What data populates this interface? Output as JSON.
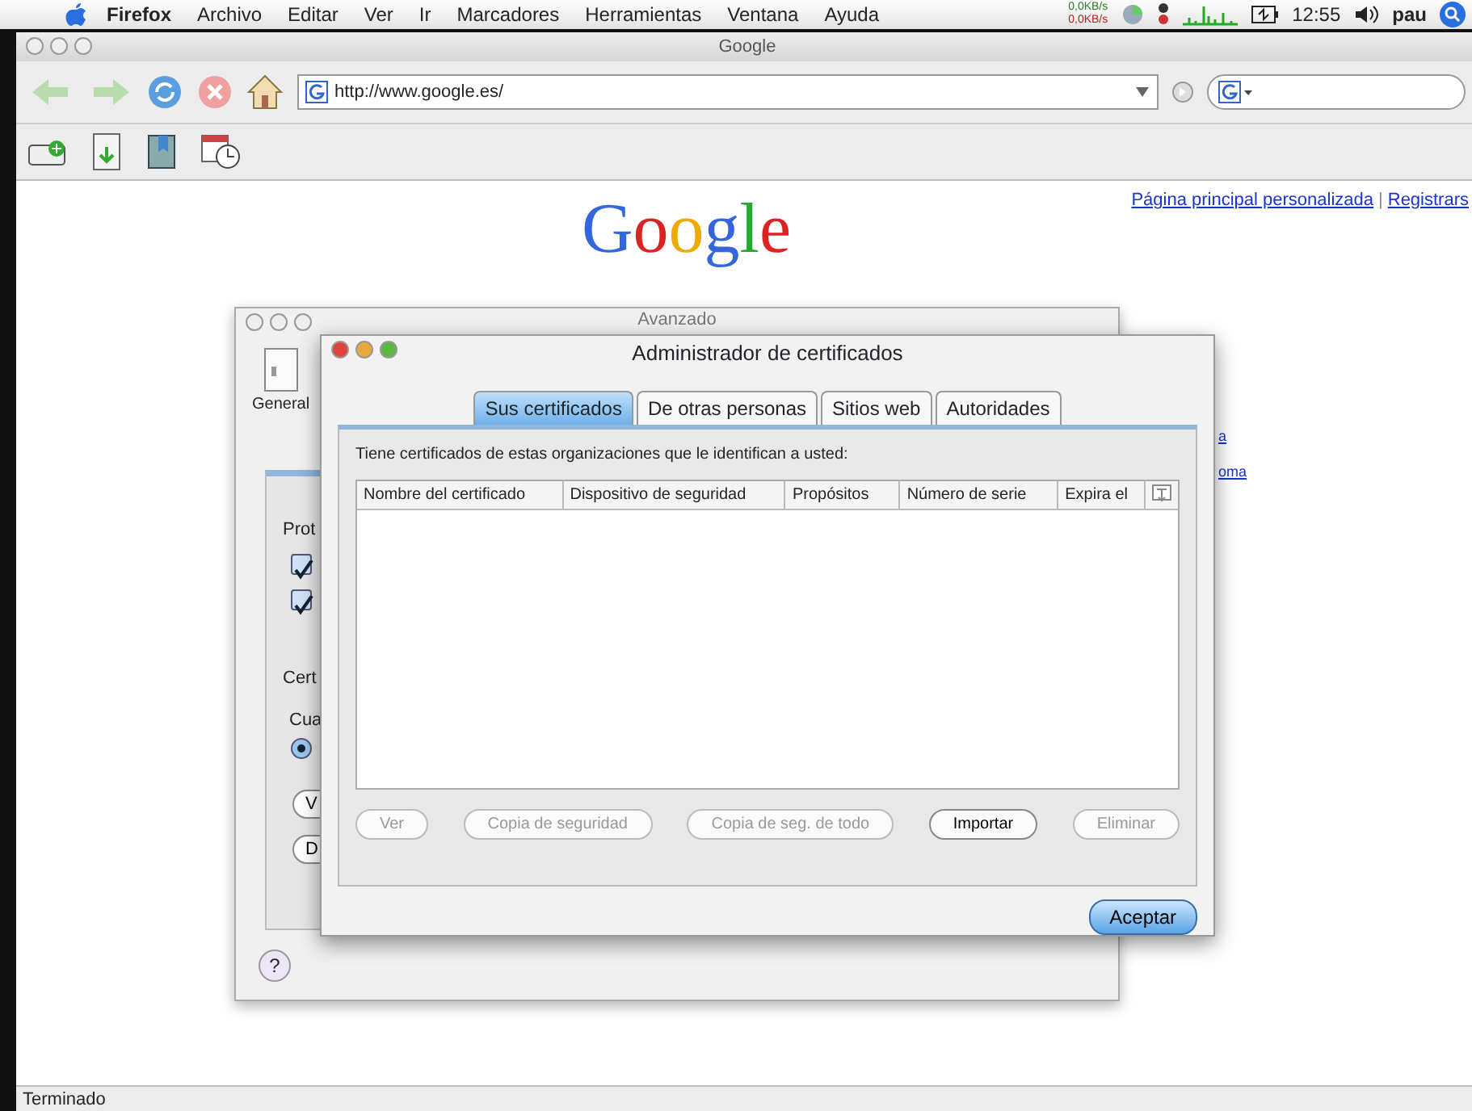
{
  "menubar": {
    "app": "Firefox",
    "menus": [
      "Archivo",
      "Editar",
      "Ver",
      "Ir",
      "Marcadores",
      "Herramientas",
      "Ventana",
      "Ayuda"
    ],
    "net_speed": [
      "0,0KB/s",
      "0,0KB/s"
    ],
    "clock": "12:55",
    "user": "pau"
  },
  "browser": {
    "title": "Google",
    "url": "http://www.google.es/",
    "logo": "Google",
    "header_links": [
      "Página principal personalizada",
      "Registrars"
    ],
    "header_separator": "|",
    "side_links": [
      "a",
      "oma"
    ],
    "status": "Terminado"
  },
  "advanced_window": {
    "title": "Avanzado",
    "toolbar_item": "General",
    "fragments": [
      "Prot",
      "Cert",
      "Cua"
    ],
    "checkboxes": [
      {
        "checked": true
      },
      {
        "checked": true
      }
    ],
    "radio": {
      "selected": true
    },
    "button_fragments": [
      "V",
      "D"
    ],
    "help_button": "?"
  },
  "certificate_dialog": {
    "title": "Administrador de certificados",
    "tabs": [
      {
        "label": "Sus certificados",
        "selected": true
      },
      {
        "label": "De otras personas",
        "selected": false
      },
      {
        "label": "Sitios web",
        "selected": false
      },
      {
        "label": "Autoridades",
        "selected": false
      }
    ],
    "description": "Tiene certificados de estas organizaciones que le identifican a usted:",
    "columns": [
      "Nombre del certificado",
      "Dispositivo de seguridad",
      "Propósitos",
      "Número de serie",
      "Expira el"
    ],
    "buttons": [
      {
        "label": "Ver",
        "disabled": true
      },
      {
        "label": "Copia de seguridad",
        "disabled": true
      },
      {
        "label": "Copia de seg. de todo",
        "disabled": true
      },
      {
        "label": "Importar",
        "disabled": false
      },
      {
        "label": "Eliminar",
        "disabled": true
      }
    ],
    "ok_button": "Aceptar"
  }
}
